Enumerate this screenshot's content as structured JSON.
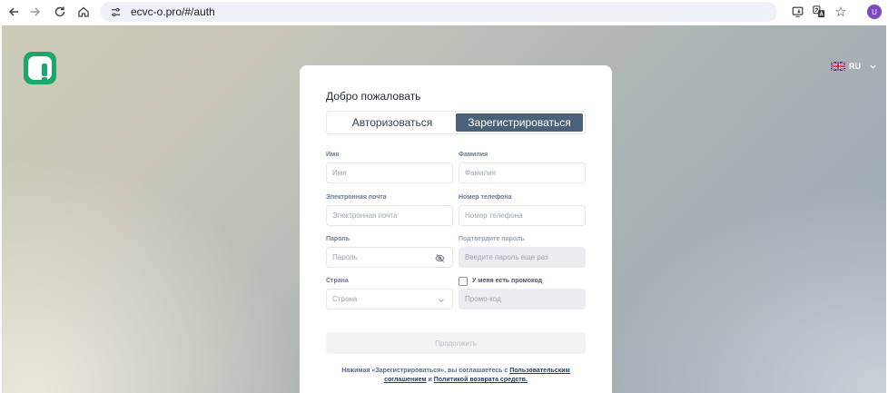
{
  "browser": {
    "url": "ecvc-o.pro/#/auth",
    "profile_initial": "U",
    "star_glyph": "☆"
  },
  "header": {
    "lang_code": "RU"
  },
  "card": {
    "welcome": "Добро пожаловать",
    "tabs": [
      {
        "label": "Авторизоваться",
        "active": false
      },
      {
        "label": "Зарегистрироваться",
        "active": true
      }
    ],
    "fields": {
      "first_name": {
        "label": "Имя",
        "placeholder": "Имя"
      },
      "last_name": {
        "label": "Фамилия",
        "placeholder": "Фамилия"
      },
      "email": {
        "label": "Электронная почта",
        "placeholder": "Электронная почта"
      },
      "phone": {
        "label": "Номер телефона",
        "placeholder": "Номер телефона"
      },
      "password": {
        "label": "Пароль",
        "placeholder": "Пароль"
      },
      "password_confirm": {
        "label": "Подтвердите пароль",
        "placeholder": "Введите пароль еще раз"
      },
      "country": {
        "label": "Страна",
        "placeholder": "Страна"
      },
      "promo": {
        "checkbox_label": "У меня есть промокод",
        "placeholder": "Промо-код"
      }
    },
    "continue_label": "Продолжить",
    "terms": {
      "prefix": "Нажимая «Зарегистрироваться», вы соглашаетесь с ",
      "user_agreement": "Пользовательским соглашением",
      "conjunction": " и ",
      "refund_policy": "Политикой возврата средств."
    }
  },
  "colors": {
    "brand_green": "#1ea76a",
    "active_tab": "#4b6179",
    "profile": "#7b4ac2"
  }
}
